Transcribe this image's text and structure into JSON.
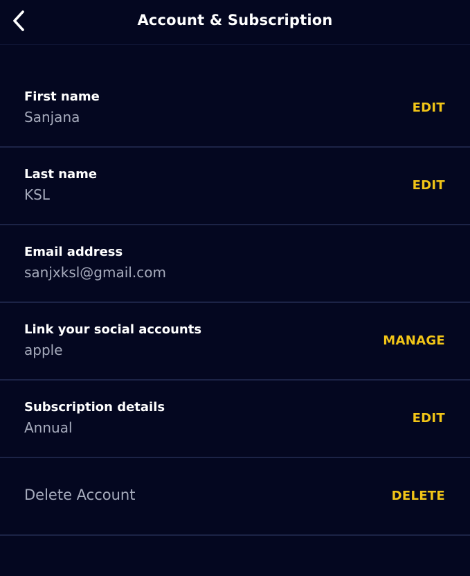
{
  "header": {
    "title": "Account & Subscription",
    "back_icon": "chevron-left-icon"
  },
  "rows": [
    {
      "label": "First name",
      "value": "Sanjana",
      "action": "EDIT"
    },
    {
      "label": "Last name",
      "value": "KSL",
      "action": "EDIT"
    },
    {
      "label": "Email address",
      "value": "sanjxksl@gmail.com"
    },
    {
      "label": "Link your social accounts",
      "value": "apple",
      "action": "MANAGE"
    },
    {
      "label": "Subscription details",
      "value": "Annual",
      "action": "EDIT"
    }
  ],
  "delete_row": {
    "label": "Delete Account",
    "action": "DELETE"
  },
  "colors": {
    "background": "#040720",
    "accent": "#f2c517",
    "divider": "#1c2346",
    "secondary_text": "#a7acbd"
  }
}
